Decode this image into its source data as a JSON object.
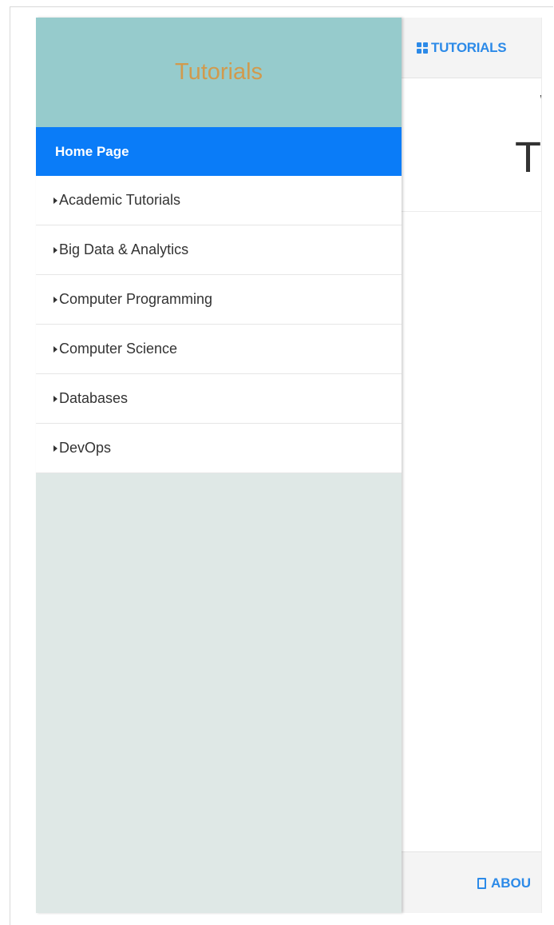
{
  "sidebar": {
    "title": "Tutorials",
    "items": [
      {
        "label": "Home Page",
        "active": true
      },
      {
        "label": "Academic Tutorials",
        "icon": "caret-right-icon"
      },
      {
        "label": "Big Data & Analytics",
        "icon": "caret-right-icon"
      },
      {
        "label": "Computer Programming",
        "icon": "caret-right-icon"
      },
      {
        "label": "Computer Science",
        "icon": "caret-right-icon"
      },
      {
        "label": "Databases",
        "icon": "caret-right-icon"
      },
      {
        "label": "DevOps",
        "icon": "caret-right-icon"
      }
    ]
  },
  "main": {
    "nav": {
      "tutorials_label": "TUTORIALS",
      "tutorials_icon": "grid-icon"
    },
    "hero": {
      "small_text": "\\",
      "big_text": "T"
    },
    "footer": {
      "about_label": "ABOU",
      "about_icon": "document-icon"
    }
  },
  "colors": {
    "sidebar_header_bg": "#96cbcc",
    "sidebar_title": "#d19a4d",
    "active_item_bg": "#0a7cf8",
    "sidebar_bg": "#dfe8e6",
    "link_blue": "#2c8ae8"
  }
}
